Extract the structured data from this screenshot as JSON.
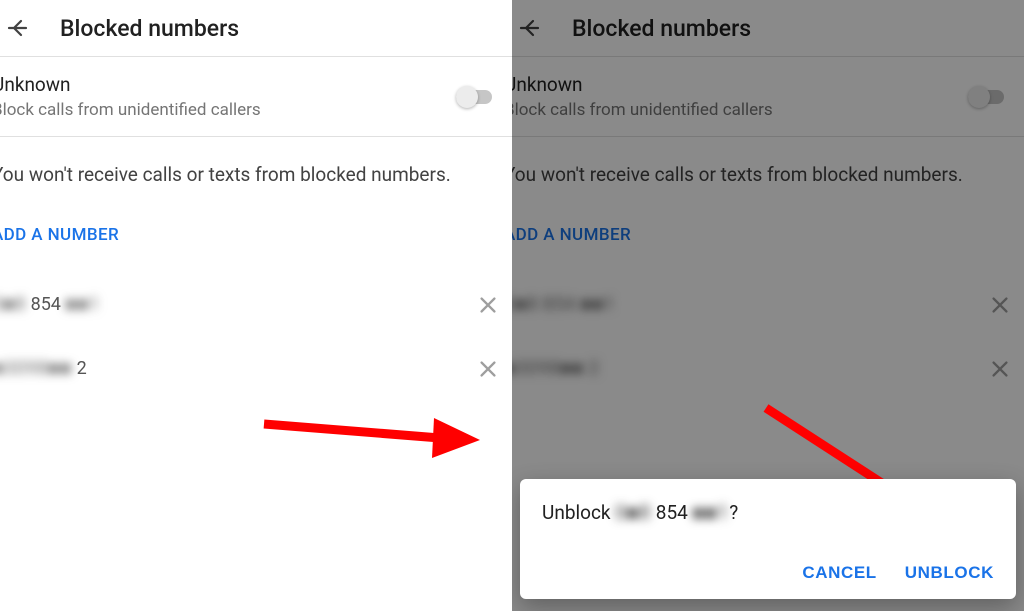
{
  "header": {
    "title": "Blocked numbers"
  },
  "unknown": {
    "title": "Unknown",
    "subtitle": "Block calls from unidentified callers",
    "enabled": false
  },
  "info_text": "You won't receive calls or texts from blocked numbers.",
  "add_number_label": "ADD A NUMBER",
  "blocked": [
    {
      "masked_prefix": "0■8",
      "masked_mid": "854",
      "masked_suffix": "■■1"
    },
    {
      "masked_prefix": "■3098■■",
      "masked_mid": "",
      "masked_suffix": "2"
    }
  ],
  "dialog": {
    "prefix": "Unblock ",
    "num_a": "0■8",
    "num_b": "854",
    "num_c": "■■1",
    "suffix": "?",
    "cancel": "CANCEL",
    "confirm": "UNBLOCK"
  },
  "colors": {
    "accent": "#1a73e8",
    "arrow": "#ff0000"
  }
}
